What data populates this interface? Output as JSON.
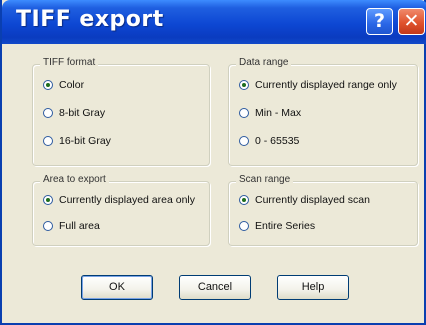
{
  "window": {
    "title": "TIFF export"
  },
  "titlebar": {
    "help_glyph": "?",
    "close_glyph": "✕"
  },
  "tiff_format": {
    "legend": "TIFF format",
    "options": [
      {
        "label": "Color",
        "selected": true
      },
      {
        "label": "8-bit Gray",
        "selected": false
      },
      {
        "label": "16-bit Gray",
        "selected": false
      }
    ]
  },
  "data_range": {
    "legend": "Data range",
    "options": [
      {
        "label": "Currently displayed range only",
        "selected": true
      },
      {
        "label": "Min - Max",
        "selected": false
      },
      {
        "label": "0 - 65535",
        "selected": false
      }
    ]
  },
  "area_to_export": {
    "legend": "Area to export",
    "options": [
      {
        "label": "Currently displayed area only",
        "selected": true
      },
      {
        "label": "Full area",
        "selected": false
      }
    ]
  },
  "scan_range": {
    "legend": "Scan range",
    "options": [
      {
        "label": "Currently displayed scan",
        "selected": true
      },
      {
        "label": "Entire Series",
        "selected": false
      }
    ]
  },
  "buttons": {
    "ok": "OK",
    "cancel": "Cancel",
    "help": "Help"
  }
}
